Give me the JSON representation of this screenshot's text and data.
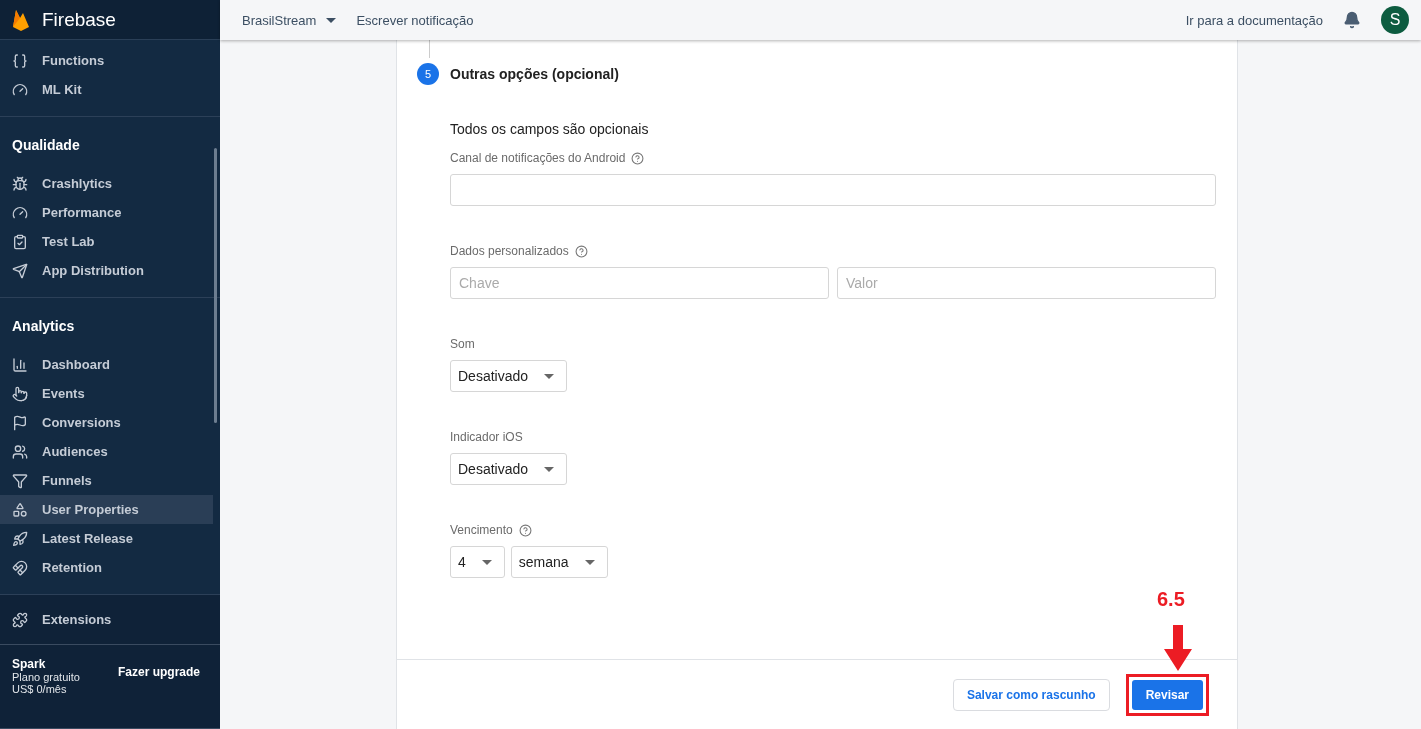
{
  "sidebar": {
    "brand": "Firebase",
    "groups": [
      {
        "items": [
          {
            "label": "Functions",
            "selected": false
          },
          {
            "label": "ML Kit",
            "selected": false
          }
        ]
      },
      {
        "title": "Qualidade",
        "items": [
          {
            "label": "Crashlytics",
            "selected": false
          },
          {
            "label": "Performance",
            "selected": false
          },
          {
            "label": "Test Lab",
            "selected": false
          },
          {
            "label": "App Distribution",
            "selected": false
          }
        ]
      },
      {
        "title": "Analytics",
        "items": [
          {
            "label": "Dashboard",
            "selected": false
          },
          {
            "label": "Events",
            "selected": false
          },
          {
            "label": "Conversions",
            "selected": false
          },
          {
            "label": "Audiences",
            "selected": false
          },
          {
            "label": "Funnels",
            "selected": false
          },
          {
            "label": "User Properties",
            "selected": true
          },
          {
            "label": "Latest Release",
            "selected": false
          },
          {
            "label": "Retention",
            "selected": false
          }
        ]
      }
    ],
    "extensions": "Extensions",
    "plan": {
      "name": "Spark",
      "description": "Plano gratuito",
      "price": "US$ 0/mês",
      "upgrade": "Fazer upgrade"
    }
  },
  "topbar": {
    "project": "BrasilStream",
    "page": "Escrever notificação",
    "docs_link": "Ir para a documentação",
    "avatar": "S"
  },
  "step": {
    "number": "5",
    "title": "Outras opções (opcional)"
  },
  "form": {
    "heading": "Todos os campos são opcionais",
    "fields": [
      {
        "kind": "text",
        "label": "Canal de notificações do Android",
        "help": true
      },
      {
        "kind": "pair",
        "label": "Dados personalizados",
        "help": true,
        "placeholders": [
          "Chave",
          "Valor"
        ]
      },
      {
        "kind": "select",
        "label": "Som",
        "help": false,
        "values": [
          "Desativado"
        ]
      },
      {
        "kind": "select",
        "label": "Indicador iOS",
        "help": false,
        "values": [
          "Desativado"
        ]
      },
      {
        "kind": "select",
        "label": "Vencimento",
        "help": true,
        "values": [
          "4",
          "semana"
        ]
      }
    ]
  },
  "actions": {
    "draft": "Salvar como rascunho",
    "review": "Revisar"
  },
  "annotation": {
    "label": "6.5"
  }
}
